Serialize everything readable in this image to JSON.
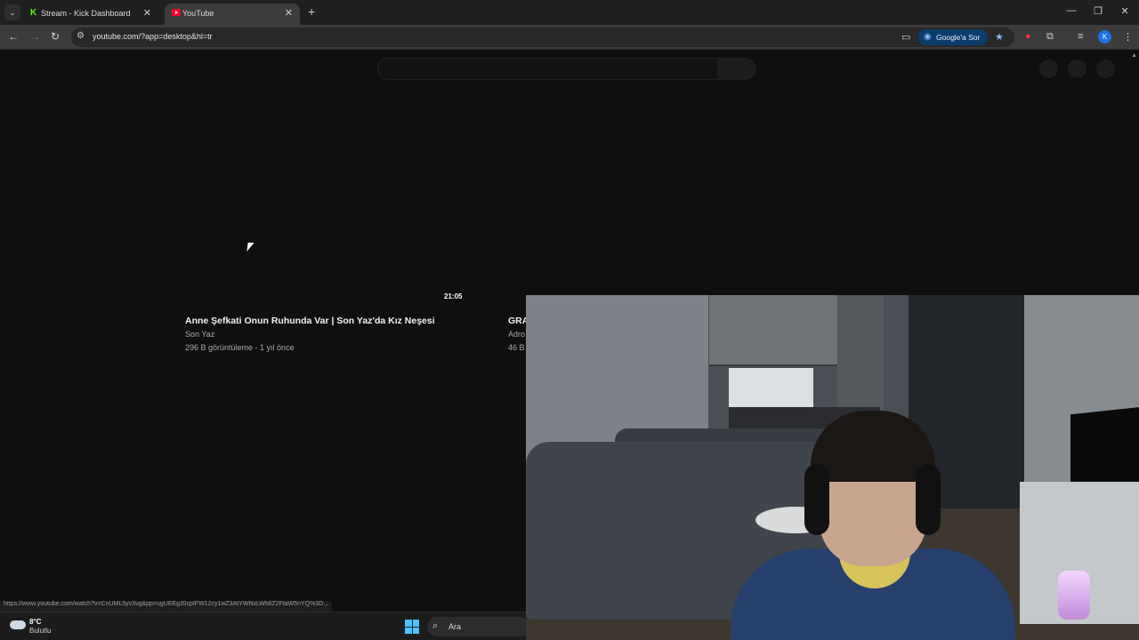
{
  "browser": {
    "tabs": [
      {
        "title": "Stream - Kick Dashboard",
        "favicon": "kick-icon",
        "active": false
      },
      {
        "title": "YouTube",
        "favicon": "youtube-icon",
        "active": true
      }
    ],
    "new_tab": "+",
    "url": "youtube.com/?app=desktop&hl=tr",
    "ask_google": "Google'a Sor",
    "profile_initial": "K",
    "status_url": "https://www.youtube.com/watch?v=CnUML5yv3vg&pp=ugUEEgJ0cpIFW12cy1wZ3AtYWNxLWMiZ2FtaW5nYQ%3D..."
  },
  "youtube": {
    "videos": [
      {
        "duration": "21:05",
        "title": "Anne Şefkati Onun Ruhunda Var | Son Yaz'da Kız Neşesi",
        "channel": "Son Yaz",
        "meta": "296 B görüntüleme - 1 yıl önce"
      },
      {
        "duration": "",
        "title": "GRA",
        "channel": "Adro",
        "meta": "46 B"
      }
    ]
  },
  "taskbar": {
    "weather_temp": "8°C",
    "weather_desc": "Bulutlu",
    "search_label": "Ara"
  },
  "colors": {
    "page_bg": "#0f0f0f",
    "accent_blue": "#1a73e8",
    "windows_blue": "#4cc2ff"
  }
}
